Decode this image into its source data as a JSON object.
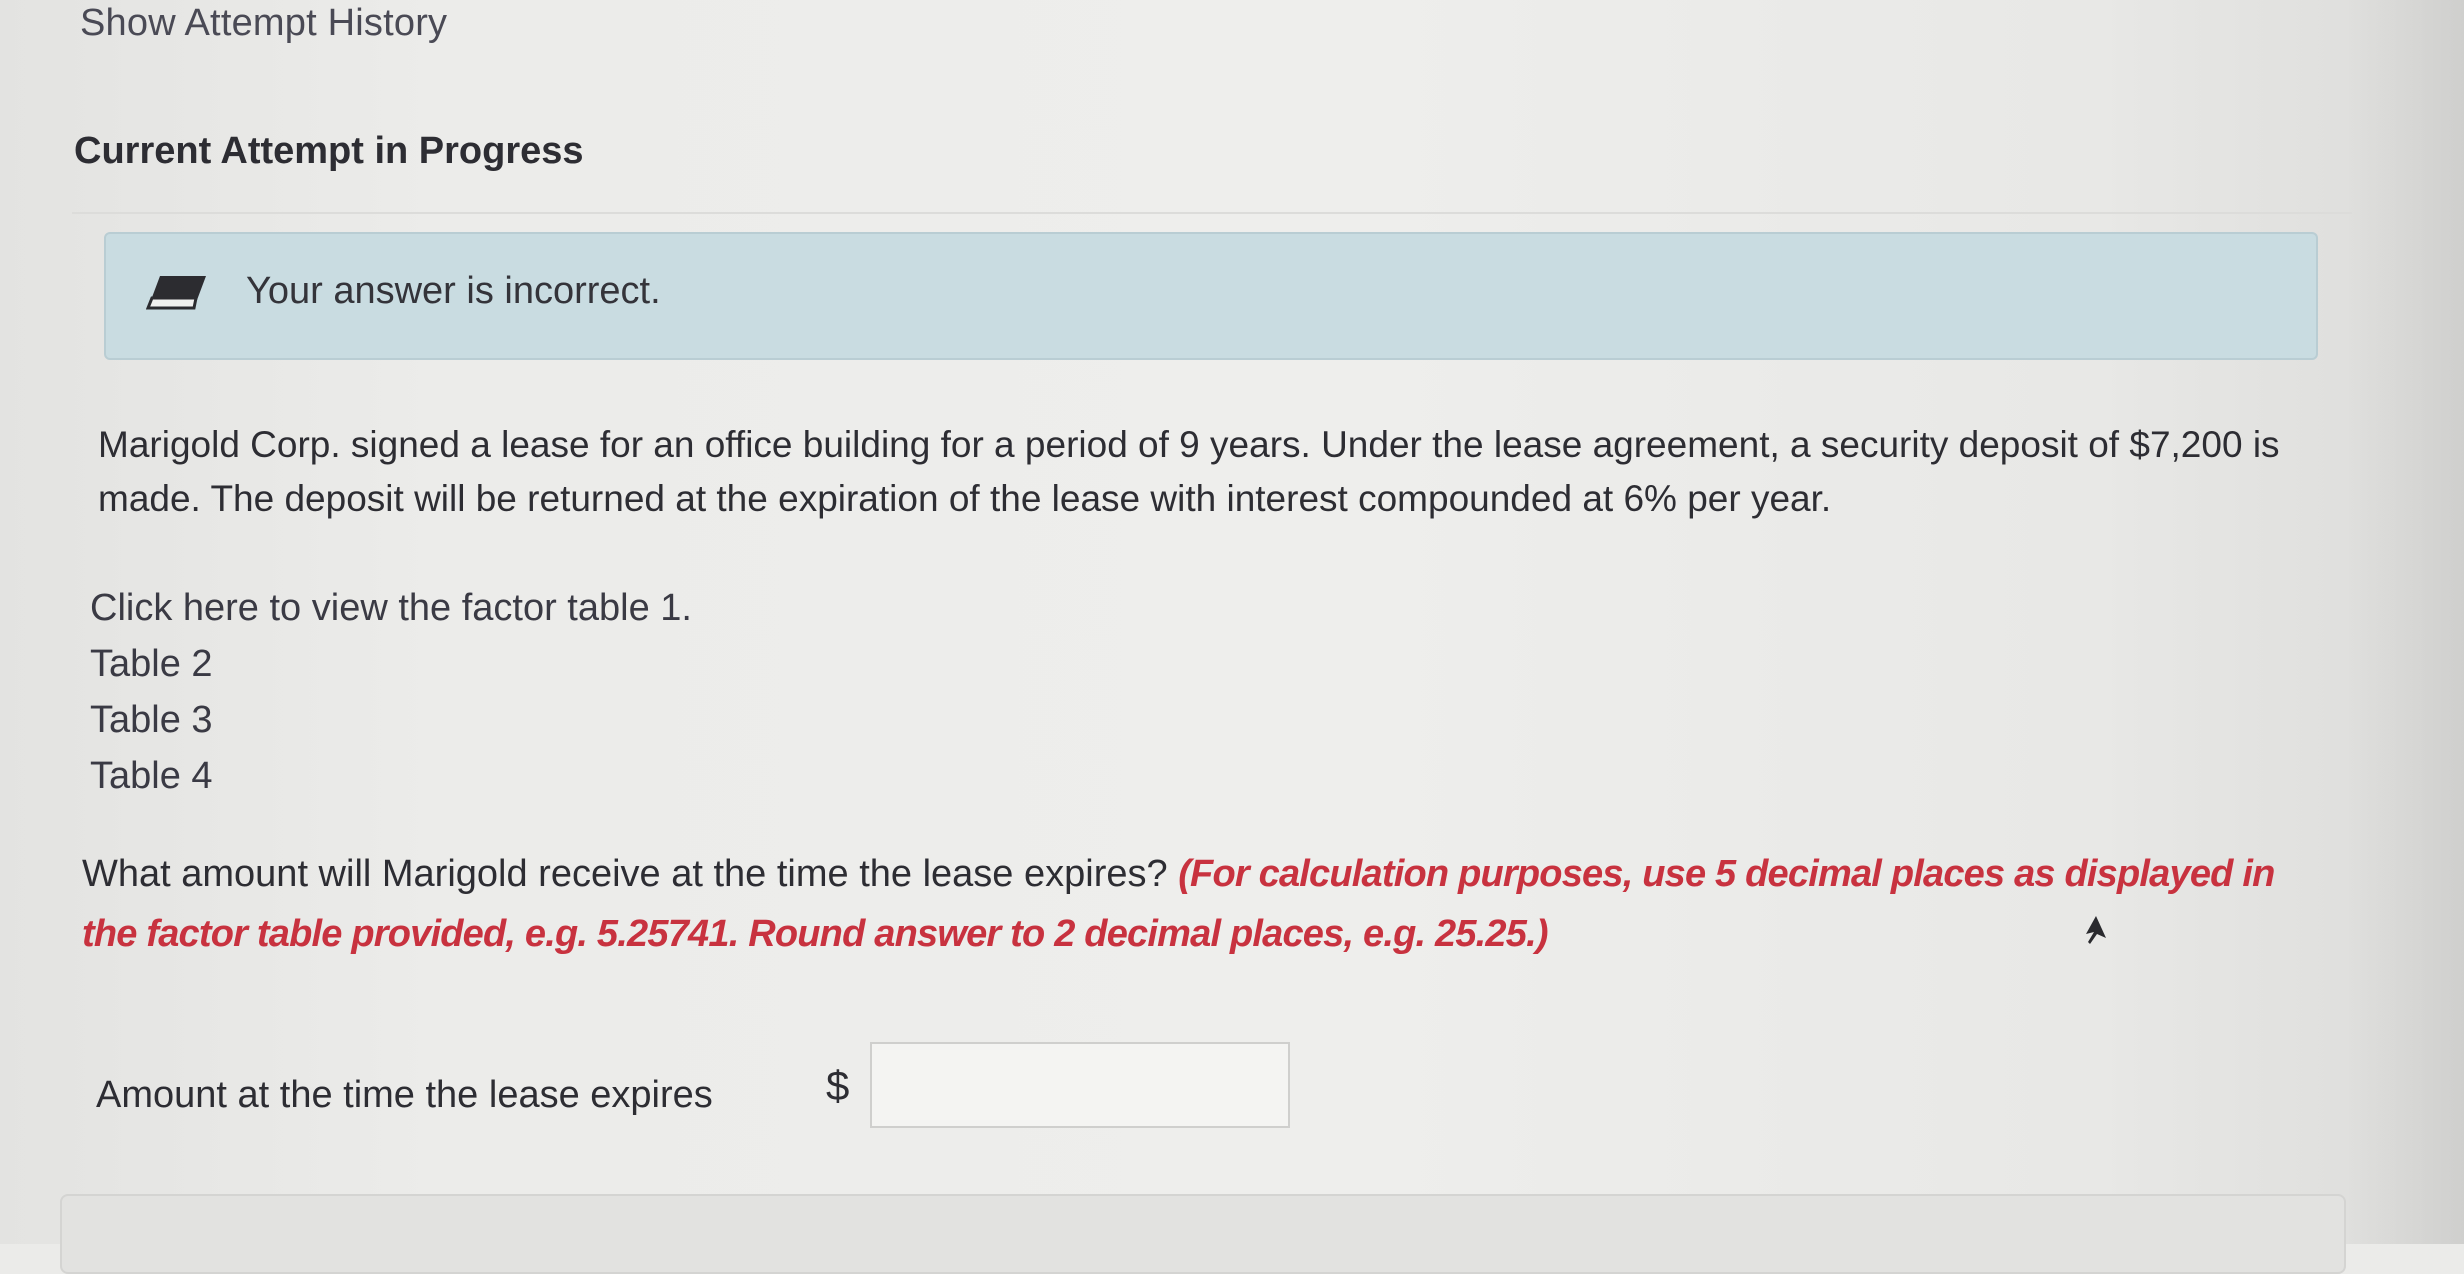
{
  "history": {
    "label": "Show Attempt History"
  },
  "attempt": {
    "title": "Current Attempt in Progress"
  },
  "feedback": {
    "icon": "pencil-eraser-icon",
    "message": "Your answer is incorrect."
  },
  "problem": {
    "text": "Marigold Corp. signed a lease for an office building for a period of 9 years. Under the lease agreement, a security deposit of $7,200 is made. The deposit will be returned at the expiration of the lease with interest compounded at 6% per year."
  },
  "tables": {
    "links": [
      "Click here to view the factor table 1.",
      "Table 2",
      "Table 3",
      "Table 4"
    ]
  },
  "question": {
    "text": "What amount will Marigold receive at the time the lease expires?",
    "instructions": "(For calculation purposes, use 5 decimal places as displayed in the factor table provided, e.g. 5.25741. Round answer to 2 decimal places, e.g. 25.25.)"
  },
  "answer": {
    "label": "Amount at the time the lease expires",
    "currency": "$",
    "value": ""
  },
  "colors": {
    "banner": "#c9dce1",
    "instruction": "#c8323f",
    "background": "#ececea"
  }
}
